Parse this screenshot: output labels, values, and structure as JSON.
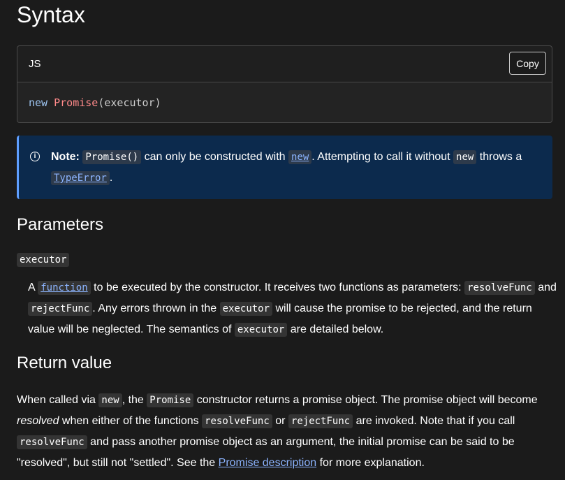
{
  "syntax": {
    "heading": "Syntax",
    "lang": "JS",
    "copy_label": "Copy",
    "code": {
      "keyword": "new",
      "class": "Promise",
      "args": "(executor)"
    }
  },
  "note": {
    "label": "Note:",
    "code_promise": "Promise()",
    "t1": " can only be constructed with ",
    "code_new": "new",
    "t2": ". Attempting to call it without ",
    "code_new2": "new",
    "t3": " throws a ",
    "code_typeerror": "TypeError",
    "t4": "."
  },
  "parameters": {
    "heading": "Parameters",
    "term": "executor",
    "d1": "A ",
    "link_function": "function",
    "d2": " to be executed by the constructor. It receives two functions as parameters: ",
    "code_resolve": "resolveFunc",
    "d3": " and ",
    "code_reject": "rejectFunc",
    "d4": ". Any errors thrown in the ",
    "code_executor": "executor",
    "d5": " will cause the promise to be rejected, and the return value will be neglected. The semantics of ",
    "code_executor2": "executor",
    "d6": " are detailed below."
  },
  "return_value": {
    "heading": "Return value",
    "r1": "When called via ",
    "code_new": "new",
    "r2": ", the ",
    "code_promise": "Promise",
    "r3": " constructor returns a promise object. The promise object will become ",
    "em_resolved": "resolved",
    "r4": " when either of the functions ",
    "code_resolve": "resolveFunc",
    "r5": " or ",
    "code_reject": "rejectFunc",
    "r6": " are invoked. Note that if you call ",
    "code_resolve2": "resolveFunc",
    "r7": " and pass another promise object as an argument, the initial promise can be said to be \"resolved\", but still not \"settled\". See the ",
    "link_desc": "Promise description",
    "r8": " for more explanation."
  }
}
